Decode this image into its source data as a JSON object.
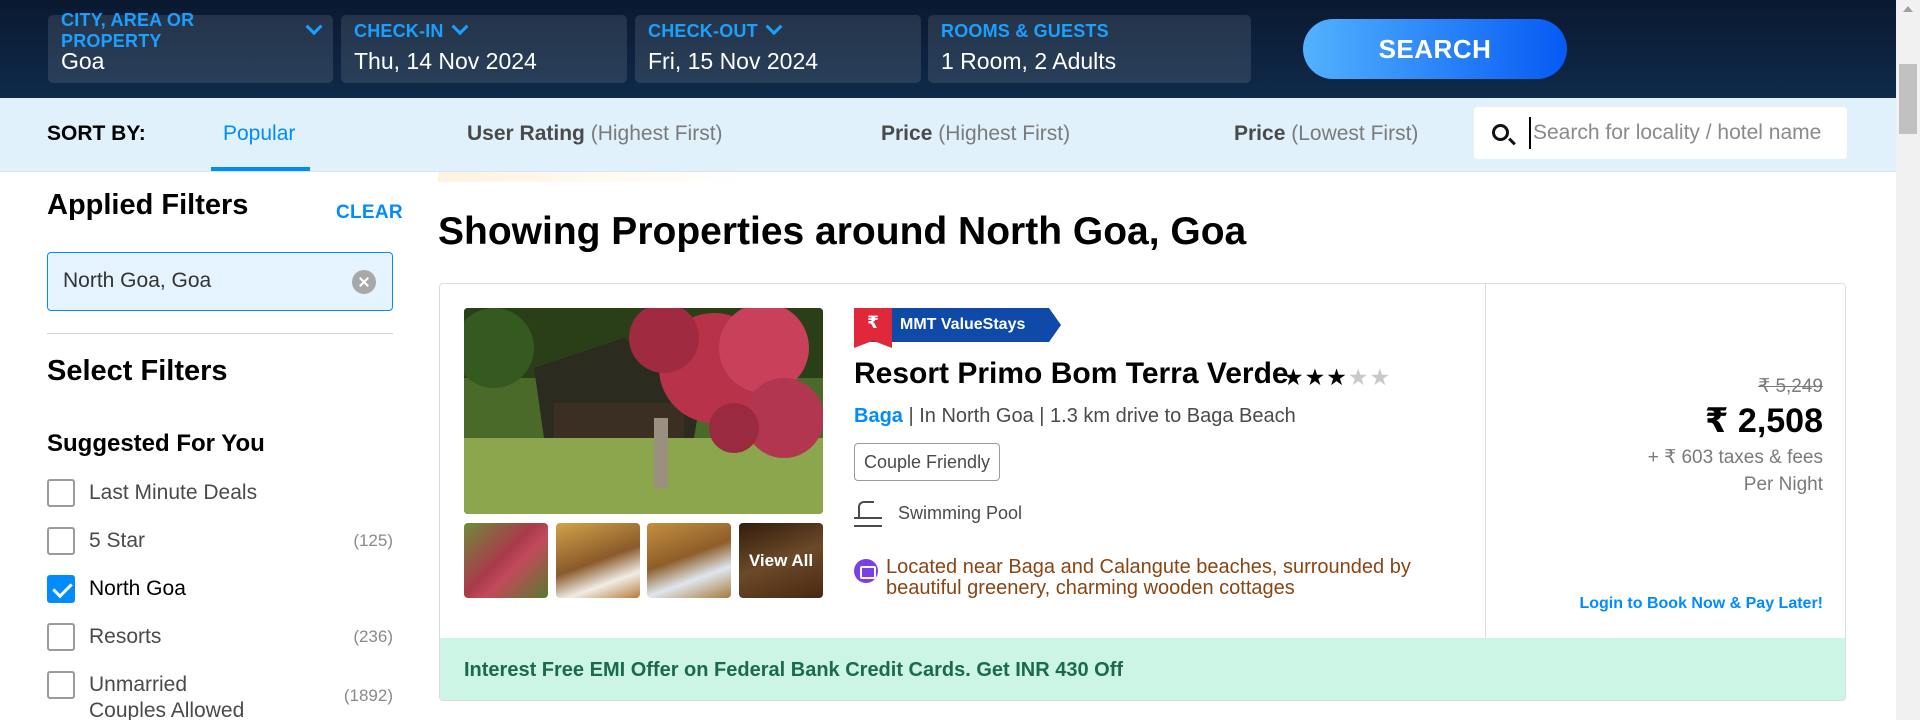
{
  "topbar": {
    "fields": [
      {
        "label": "CITY, AREA OR PROPERTY",
        "value": "Goa"
      },
      {
        "label": "CHECK-IN",
        "value": "Thu, 14 Nov 2024"
      },
      {
        "label": "CHECK-OUT",
        "value": "Fri, 15 Nov 2024"
      },
      {
        "label": "ROOMS & GUESTS",
        "value": "1 Room, 2 Adults"
      }
    ],
    "search_label": "SEARCH"
  },
  "sortbar": {
    "label": "SORT BY:",
    "options": [
      {
        "main": "Popular",
        "sub": ""
      },
      {
        "main": "User Rating",
        "sub": "(Highest First)"
      },
      {
        "main": "Price",
        "sub": "(Highest First)"
      },
      {
        "main": "Price",
        "sub": "(Lowest First)"
      }
    ],
    "active_index": 0,
    "search_placeholder": "Search for locality / hotel name"
  },
  "sidebar": {
    "applied_title": "Applied Filters",
    "clear_label": "CLEAR",
    "applied_chip": "North Goa, Goa",
    "select_title": "Select Filters",
    "suggested_title": "Suggested For You",
    "filters": [
      {
        "name": "Last Minute Deals",
        "count": "",
        "checked": false
      },
      {
        "name": "5 Star",
        "count": "(125)",
        "checked": false
      },
      {
        "name": "North Goa",
        "count": "",
        "checked": true
      },
      {
        "name": "Resorts",
        "count": "(236)",
        "checked": false
      },
      {
        "name": "Unmarried Couples Allowed",
        "count": "(1892)",
        "checked": false
      }
    ]
  },
  "main": {
    "heading": "Showing Properties around North Goa, Goa",
    "card": {
      "badge": "MMT ValueStays",
      "badge_icon": "₹",
      "name": "Resort Primo Bom Terra Verde",
      "stars_filled": 3,
      "stars_total": 5,
      "area_link": "Baga",
      "location_rest": " | In North Goa | 1.3 km drive to Baga Beach",
      "tag": "Couple Friendly",
      "amenity": "Swimming Pool",
      "highlight": "Located near Baga and Calangute beaches, surrounded by beautiful greenery, charming wooden cottages",
      "view_all": "View All",
      "original_price": "₹ 5,249",
      "price": "₹ 2,508",
      "taxes": "+ ₹ 603 taxes & fees",
      "per_night": "Per Night",
      "login_text": "Login to Book Now & Pay Later!",
      "offer": "Interest Free EMI Offer on Federal Bank Credit Cards. Get INR 430 Off"
    }
  },
  "colors": {
    "brand_blue": "#008cff",
    "header_bg": "#0a1930",
    "badge_blue": "#0f4aa8",
    "offer_bg": "#cdf5e6"
  }
}
